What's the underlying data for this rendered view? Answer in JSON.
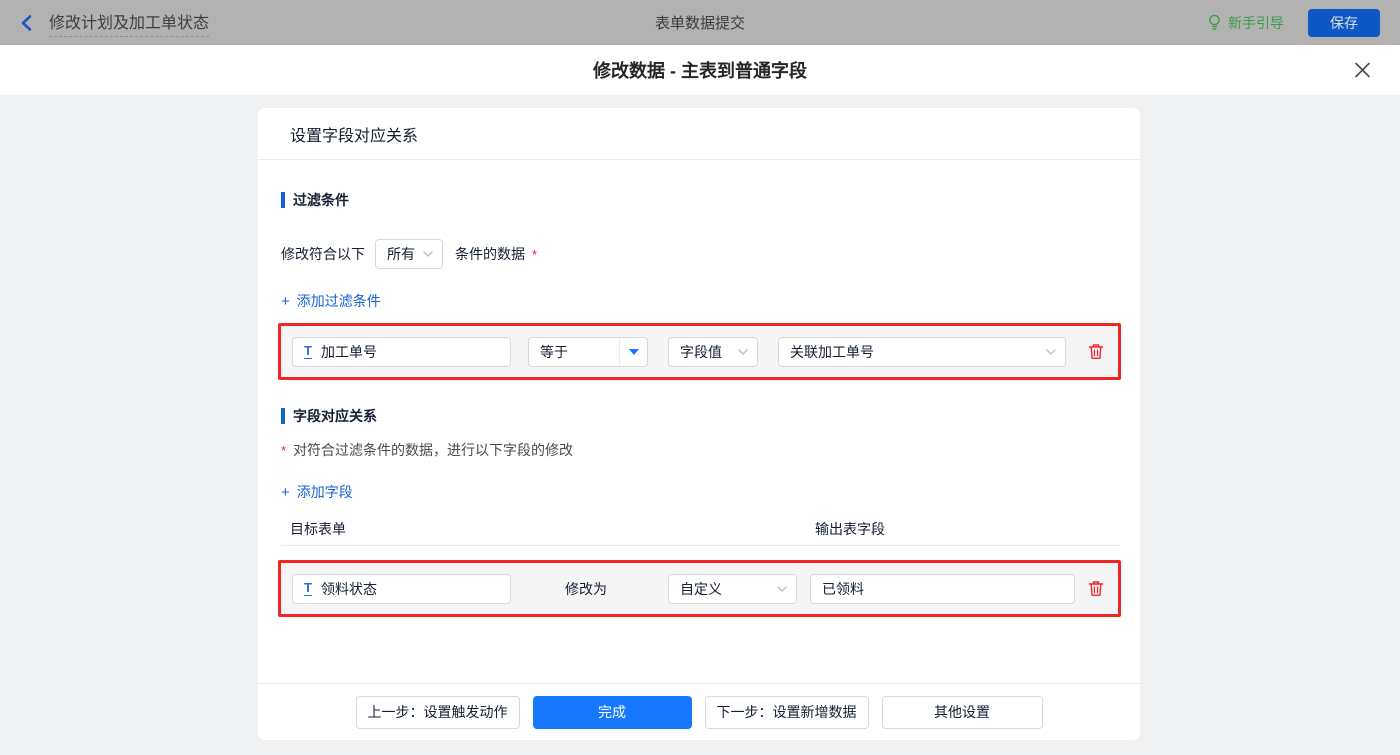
{
  "topbar": {
    "back_label": "修改计划及加工单状态",
    "title": "表单数据提交",
    "guide_label": "新手引导",
    "save_label": "保存"
  },
  "modal": {
    "title": "修改数据 - 主表到普通字段"
  },
  "panel": {
    "title": "设置字段对应关系"
  },
  "filter": {
    "section_title": "过滤条件",
    "match_prefix": "修改符合以下",
    "match_value": "所有",
    "match_suffix": "条件的数据",
    "required_mark": "*",
    "add_plus": "+",
    "add_label": "添加过滤条件",
    "row": {
      "field_icon": "T",
      "field": "加工单号",
      "operator": "等于",
      "value_type": "字段值",
      "value_field": "关联加工单号"
    }
  },
  "mapping": {
    "section_title": "字段对应关系",
    "required_mark": "*",
    "description": "对符合过滤条件的数据，进行以下字段的修改",
    "add_plus": "+",
    "add_label": "添加字段",
    "col_target": "目标表单",
    "col_output": "输出表字段",
    "row": {
      "field_icon": "T",
      "field": "领料状态",
      "action_label": "修改为",
      "value_type": "自定义",
      "value": "已领料"
    }
  },
  "footer": {
    "buttons": [
      {
        "label": "上一步：设置触发动作",
        "variant": "default"
      },
      {
        "label": "完成",
        "variant": "primary"
      },
      {
        "label": "下一步：设置新增数据",
        "variant": "default"
      },
      {
        "label": "其他设置",
        "variant": "default"
      }
    ]
  },
  "icons": {
    "back": "chevron-left",
    "guide": "lightbulb",
    "close": "x",
    "select_caret": "caret-down",
    "select_chevron": "chevron-down",
    "delete": "trash"
  },
  "colors": {
    "primary_blue": "#1677ff",
    "link_blue": "#1763d6",
    "annotation_red": "#f22424",
    "delete_red": "#f5222d",
    "guide_green": "#3a9e47",
    "topbar_gray": "#b2b2b2",
    "row_bg": "#f5f5f5"
  }
}
